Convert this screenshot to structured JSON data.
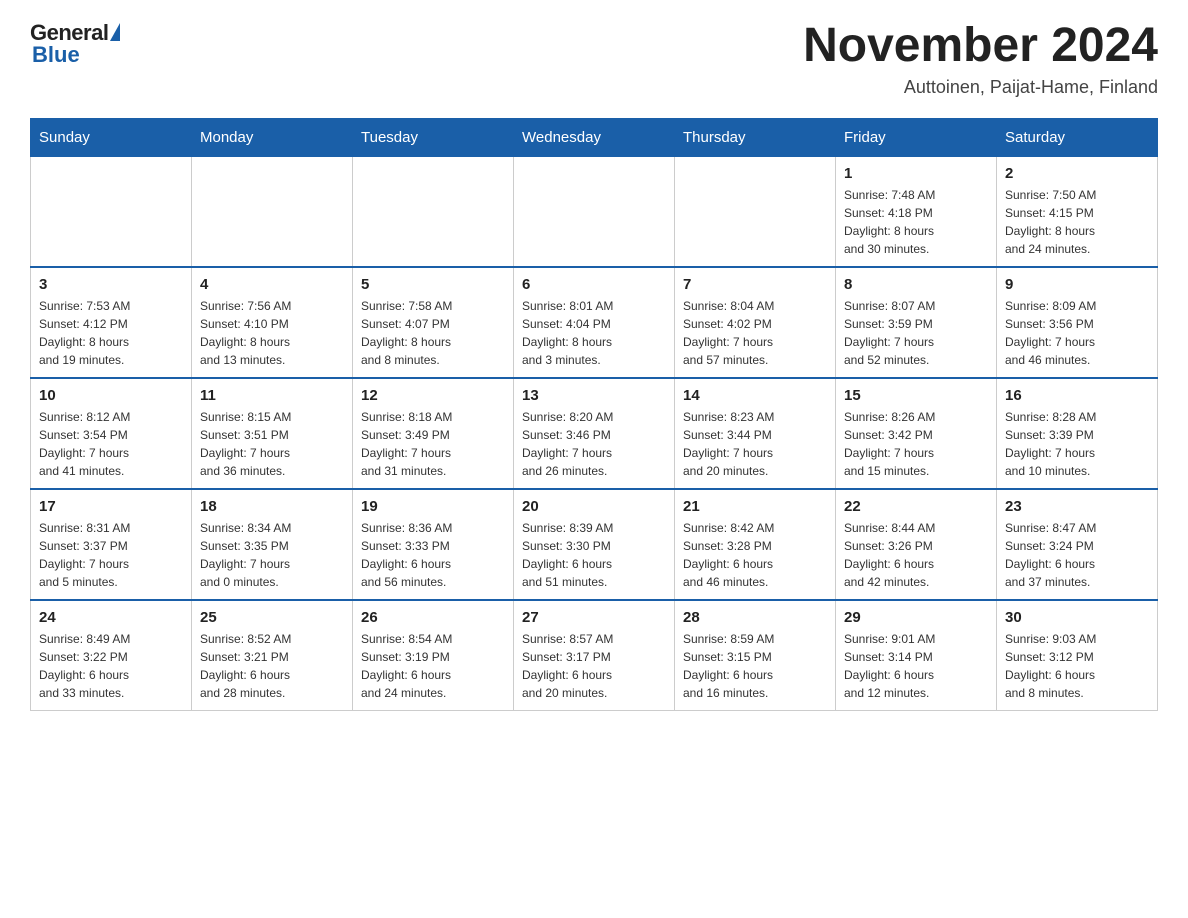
{
  "logo": {
    "general": "General",
    "blue": "Blue"
  },
  "header": {
    "month": "November 2024",
    "location": "Auttoinen, Paijat-Hame, Finland"
  },
  "weekdays": [
    "Sunday",
    "Monday",
    "Tuesday",
    "Wednesday",
    "Thursday",
    "Friday",
    "Saturday"
  ],
  "weeks": [
    [
      {
        "day": "",
        "info": ""
      },
      {
        "day": "",
        "info": ""
      },
      {
        "day": "",
        "info": ""
      },
      {
        "day": "",
        "info": ""
      },
      {
        "day": "",
        "info": ""
      },
      {
        "day": "1",
        "info": "Sunrise: 7:48 AM\nSunset: 4:18 PM\nDaylight: 8 hours\nand 30 minutes."
      },
      {
        "day": "2",
        "info": "Sunrise: 7:50 AM\nSunset: 4:15 PM\nDaylight: 8 hours\nand 24 minutes."
      }
    ],
    [
      {
        "day": "3",
        "info": "Sunrise: 7:53 AM\nSunset: 4:12 PM\nDaylight: 8 hours\nand 19 minutes."
      },
      {
        "day": "4",
        "info": "Sunrise: 7:56 AM\nSunset: 4:10 PM\nDaylight: 8 hours\nand 13 minutes."
      },
      {
        "day": "5",
        "info": "Sunrise: 7:58 AM\nSunset: 4:07 PM\nDaylight: 8 hours\nand 8 minutes."
      },
      {
        "day": "6",
        "info": "Sunrise: 8:01 AM\nSunset: 4:04 PM\nDaylight: 8 hours\nand 3 minutes."
      },
      {
        "day": "7",
        "info": "Sunrise: 8:04 AM\nSunset: 4:02 PM\nDaylight: 7 hours\nand 57 minutes."
      },
      {
        "day": "8",
        "info": "Sunrise: 8:07 AM\nSunset: 3:59 PM\nDaylight: 7 hours\nand 52 minutes."
      },
      {
        "day": "9",
        "info": "Sunrise: 8:09 AM\nSunset: 3:56 PM\nDaylight: 7 hours\nand 46 minutes."
      }
    ],
    [
      {
        "day": "10",
        "info": "Sunrise: 8:12 AM\nSunset: 3:54 PM\nDaylight: 7 hours\nand 41 minutes."
      },
      {
        "day": "11",
        "info": "Sunrise: 8:15 AM\nSunset: 3:51 PM\nDaylight: 7 hours\nand 36 minutes."
      },
      {
        "day": "12",
        "info": "Sunrise: 8:18 AM\nSunset: 3:49 PM\nDaylight: 7 hours\nand 31 minutes."
      },
      {
        "day": "13",
        "info": "Sunrise: 8:20 AM\nSunset: 3:46 PM\nDaylight: 7 hours\nand 26 minutes."
      },
      {
        "day": "14",
        "info": "Sunrise: 8:23 AM\nSunset: 3:44 PM\nDaylight: 7 hours\nand 20 minutes."
      },
      {
        "day": "15",
        "info": "Sunrise: 8:26 AM\nSunset: 3:42 PM\nDaylight: 7 hours\nand 15 minutes."
      },
      {
        "day": "16",
        "info": "Sunrise: 8:28 AM\nSunset: 3:39 PM\nDaylight: 7 hours\nand 10 minutes."
      }
    ],
    [
      {
        "day": "17",
        "info": "Sunrise: 8:31 AM\nSunset: 3:37 PM\nDaylight: 7 hours\nand 5 minutes."
      },
      {
        "day": "18",
        "info": "Sunrise: 8:34 AM\nSunset: 3:35 PM\nDaylight: 7 hours\nand 0 minutes."
      },
      {
        "day": "19",
        "info": "Sunrise: 8:36 AM\nSunset: 3:33 PM\nDaylight: 6 hours\nand 56 minutes."
      },
      {
        "day": "20",
        "info": "Sunrise: 8:39 AM\nSunset: 3:30 PM\nDaylight: 6 hours\nand 51 minutes."
      },
      {
        "day": "21",
        "info": "Sunrise: 8:42 AM\nSunset: 3:28 PM\nDaylight: 6 hours\nand 46 minutes."
      },
      {
        "day": "22",
        "info": "Sunrise: 8:44 AM\nSunset: 3:26 PM\nDaylight: 6 hours\nand 42 minutes."
      },
      {
        "day": "23",
        "info": "Sunrise: 8:47 AM\nSunset: 3:24 PM\nDaylight: 6 hours\nand 37 minutes."
      }
    ],
    [
      {
        "day": "24",
        "info": "Sunrise: 8:49 AM\nSunset: 3:22 PM\nDaylight: 6 hours\nand 33 minutes."
      },
      {
        "day": "25",
        "info": "Sunrise: 8:52 AM\nSunset: 3:21 PM\nDaylight: 6 hours\nand 28 minutes."
      },
      {
        "day": "26",
        "info": "Sunrise: 8:54 AM\nSunset: 3:19 PM\nDaylight: 6 hours\nand 24 minutes."
      },
      {
        "day": "27",
        "info": "Sunrise: 8:57 AM\nSunset: 3:17 PM\nDaylight: 6 hours\nand 20 minutes."
      },
      {
        "day": "28",
        "info": "Sunrise: 8:59 AM\nSunset: 3:15 PM\nDaylight: 6 hours\nand 16 minutes."
      },
      {
        "day": "29",
        "info": "Sunrise: 9:01 AM\nSunset: 3:14 PM\nDaylight: 6 hours\nand 12 minutes."
      },
      {
        "day": "30",
        "info": "Sunrise: 9:03 AM\nSunset: 3:12 PM\nDaylight: 6 hours\nand 8 minutes."
      }
    ]
  ]
}
